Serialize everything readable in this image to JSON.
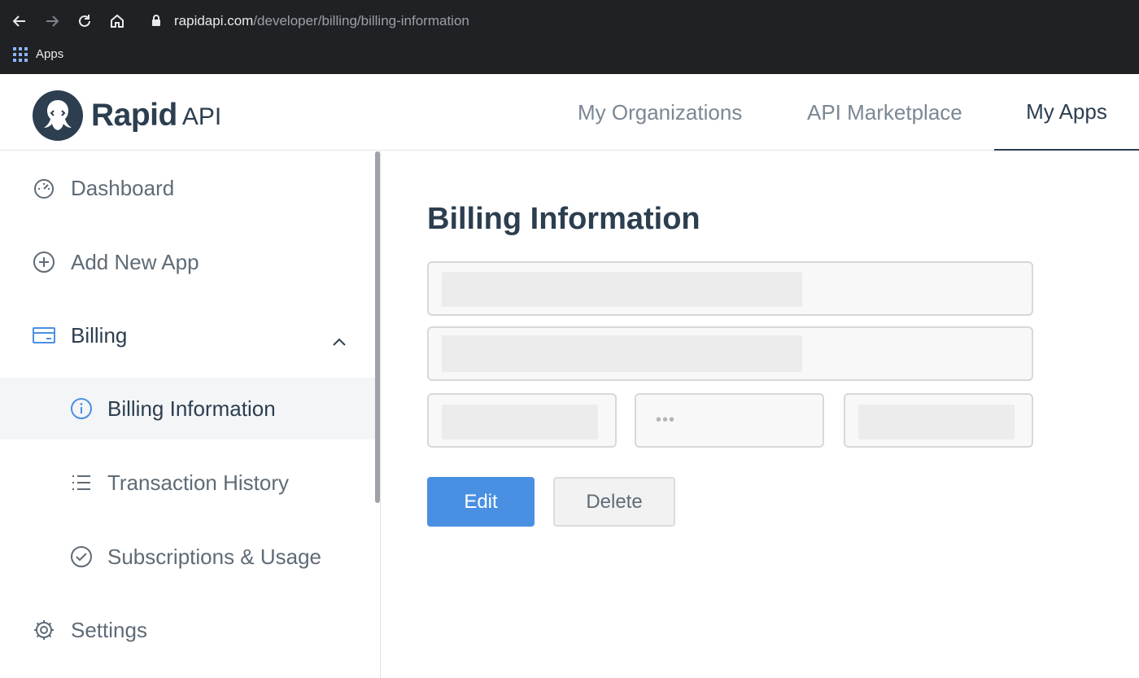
{
  "browser": {
    "url_host": "rapidapi.com",
    "url_path": "/developer/billing/billing-information",
    "bookmarks": [
      {
        "label": "Apps",
        "icon": "apps-grid-icon"
      }
    ]
  },
  "header": {
    "logo_word": "Rapid",
    "logo_suffix": "API",
    "nav": [
      {
        "label": "My Organizations",
        "active": false
      },
      {
        "label": "API Marketplace",
        "active": false
      },
      {
        "label": "My Apps",
        "active": true
      }
    ]
  },
  "sidebar": {
    "items": [
      {
        "label": "Dashboard",
        "icon": "dashboard-gauge-icon"
      },
      {
        "label": "Add New App",
        "icon": "plus-circle-icon"
      },
      {
        "label": "Billing",
        "icon": "credit-card-icon",
        "expanded": true
      },
      {
        "label": "Billing Information",
        "icon": "info-icon",
        "active": true
      },
      {
        "label": "Transaction History",
        "icon": "list-icon"
      },
      {
        "label": "Subscriptions & Usage",
        "icon": "check-circle-icon"
      },
      {
        "label": "Settings",
        "icon": "gear-icon"
      }
    ]
  },
  "main": {
    "title": "Billing Information",
    "masked_value": "•••",
    "buttons": {
      "edit": "Edit",
      "delete": "Delete"
    }
  },
  "colors": {
    "primary": "#4a90e2",
    "text_dark": "#2c3e50",
    "text_muted": "#7b8794",
    "chrome_bg": "#202124"
  }
}
